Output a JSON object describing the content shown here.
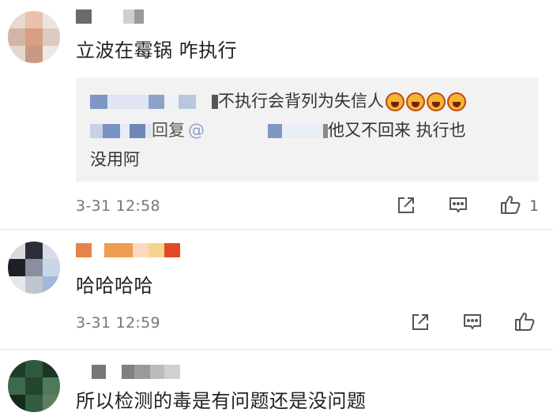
{
  "comments": [
    {
      "text": "立波在霉锅 咋执行",
      "reply": {
        "line1_text": "不执行会背列为失信人",
        "line1_emoji": "laughing-emoji",
        "line2_reply_word": "回复",
        "line2_at": "@",
        "line2_text": "他又不回来  执行也",
        "line3_text": "没用阿"
      },
      "timestamp": "3-31 12:58",
      "likes": "1"
    },
    {
      "text": "哈哈哈哈",
      "timestamp": "3-31 12:59",
      "likes": ""
    },
    {
      "text": "所以检测的毒是有问题还是没问题"
    }
  ],
  "icons": {
    "share": "share-icon",
    "comment": "comment-icon",
    "like": "thumbs-up-icon"
  },
  "colors": {
    "text": "#222222",
    "meta": "#777777",
    "quote_bg": "#f2f2f2",
    "icon": "#555555"
  }
}
